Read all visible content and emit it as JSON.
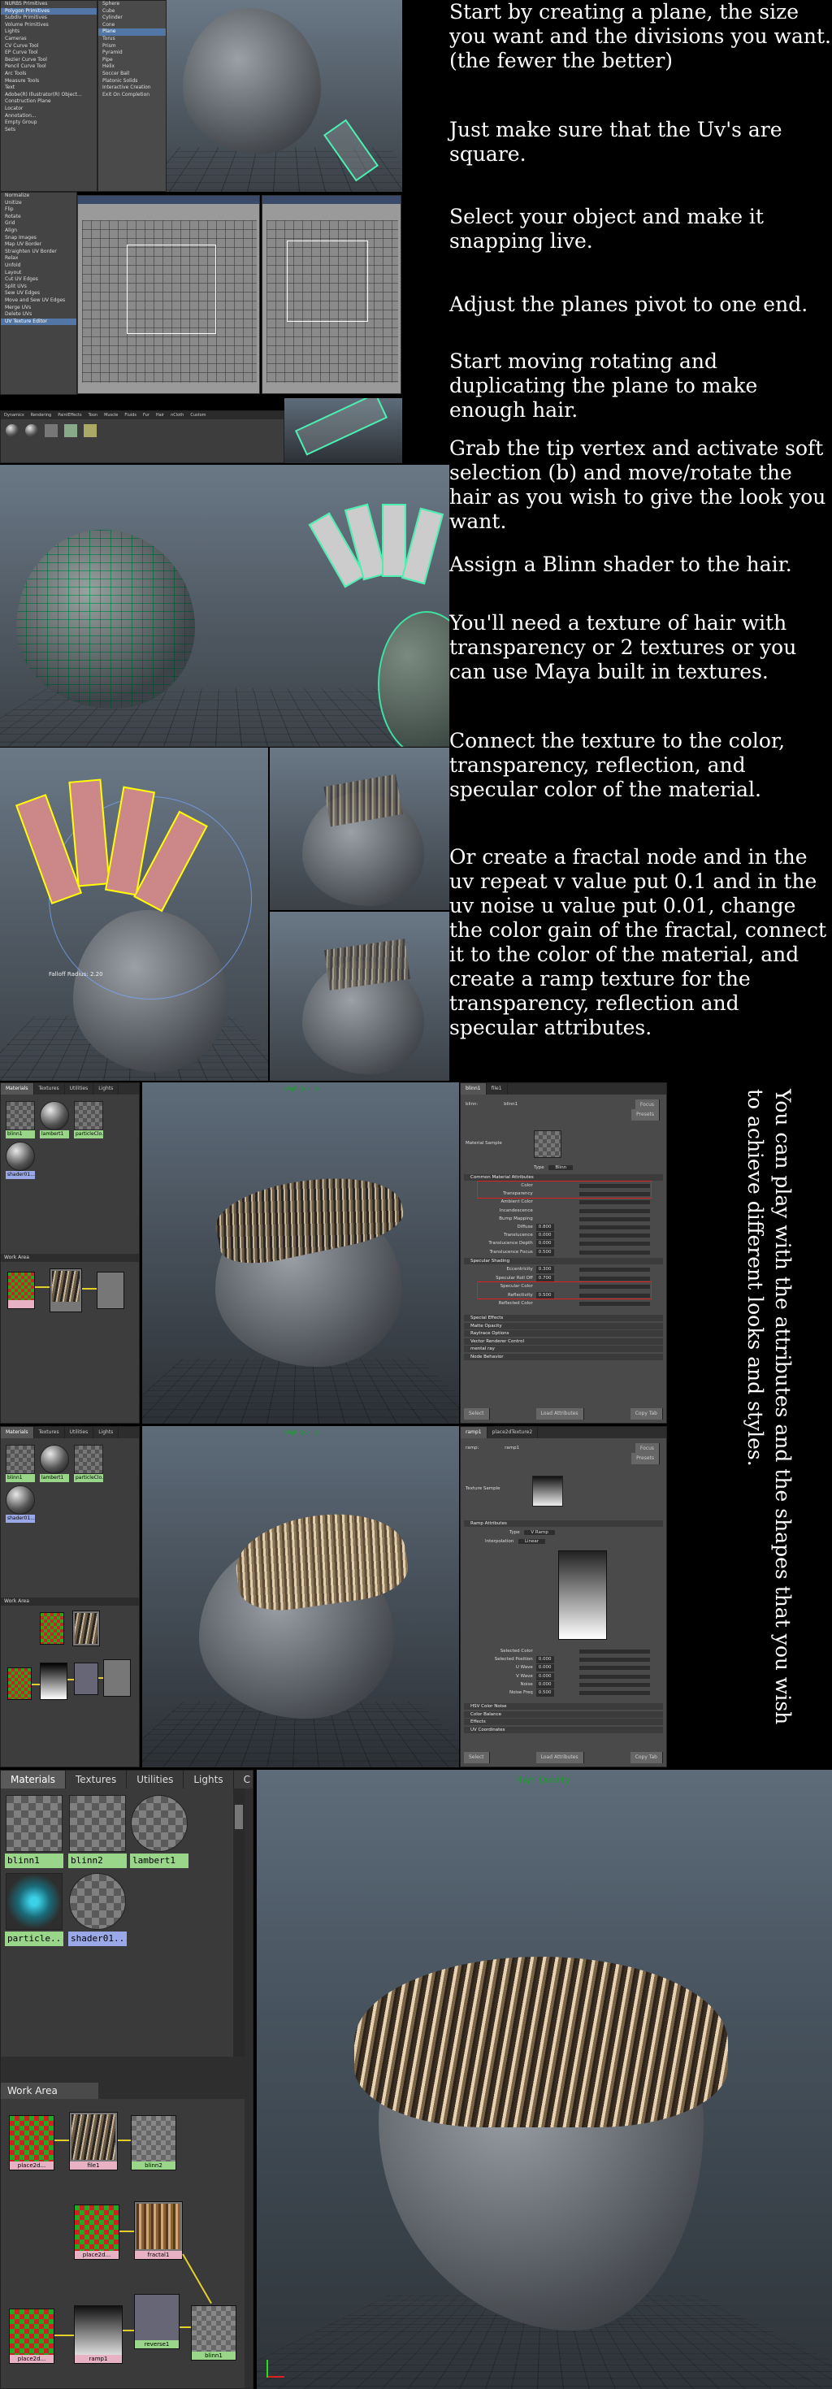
{
  "tutorial": {
    "steps": [
      "Start by creating a plane, the size you want and the divisions you want. (the fewer the better)",
      "Just make sure that the Uv's are square.",
      "Select your object and make it snapping live.",
      "Adjust the planes pivot to one end.",
      "Start moving rotating and duplicating the plane to make enough hair.",
      "Grab the tip vertex and activate soft selection (b) and move/rotate the hair as you wish to give the look you want.",
      "Assign a Blinn shader to the hair.",
      "You'll need a texture of hair with transparency or 2 textures or you can use Maya built in textures.",
      "Connect the texture to the color, transparency, reflection, and specular color of the material.",
      "Or create a fractal node and in the uv repeat v value put 0.1 and in the uv noise u value put 0.01, change the color gain of the fractal, connect it to the color of the material, and create a ramp texture for the transparency, reflection and specular attributes."
    ],
    "vertical_note": "You can play with the attributes and the shapes that you wish to achieve different looks and styles."
  },
  "create_menu": {
    "items": [
      "NURBS Primitives",
      "Polygon Primitives",
      "Subdiv Primitives",
      "Volume Primitives",
      "Lights",
      "Cameras",
      "CV Curve Tool",
      "EP Curve Tool",
      "Bezier Curve Tool",
      "Pencil Curve Tool",
      "Arc Tools",
      "Measure Tools",
      "Text",
      "Adobe(R) Illustrator(R) Object...",
      "Construction Plane",
      "Locator",
      "Annotation...",
      "Empty Group",
      "Sets"
    ],
    "selected_index": 1
  },
  "poly_submenu": {
    "items": [
      "Sphere",
      "Cube",
      "Cylinder",
      "Cone",
      "Plane",
      "Torus",
      "Prism",
      "Pyramid",
      "Pipe",
      "Helix",
      "Soccer Ball",
      "Platonic Solids",
      "Interactive Creation",
      "Exit On Completion"
    ],
    "selected_index": 4
  },
  "uv_menu": {
    "items": [
      "Normalize",
      "Unitize",
      "Flip",
      "Rotate",
      "Grid",
      "Align",
      "Snap Images",
      "Map UV Border",
      "Straighten UV Border",
      "Relax",
      "Unfold",
      "Layout",
      "Cut UV Edges",
      "Split UVs",
      "Sew UV Edges",
      "Move and Sew UV Edges",
      "Merge UVs",
      "Delete UVs",
      "UV Texture Editor"
    ],
    "selected_index": 18
  },
  "shelf_tabs": [
    "Dynamics",
    "Rendering",
    "PaintEffects",
    "Toon",
    "Muscle",
    "Fluids",
    "Fur",
    "Hair",
    "nCloth",
    "Custom"
  ],
  "soft_select_label": "Falloff Radius: 2.20",
  "render_label": "High Quality",
  "hypershade_small": {
    "tabs": [
      "Materials",
      "Textures",
      "Utilities",
      "Lights"
    ],
    "swatches": [
      "blinn1",
      "lambert1",
      "particleClo...",
      "shader01..."
    ],
    "work_area": "Work Area"
  },
  "attr_editor_1": {
    "tabs": [
      "blinn1",
      "file1"
    ],
    "node_label": "blinn:",
    "node_value": "blinn1",
    "focus": "Focus",
    "presets": "Presets",
    "sample_label": "Material Sample",
    "type_label": "Type",
    "type_value": "Blinn",
    "sections": [
      "Common Material Attributes",
      "Specular Shading",
      "Special Effects",
      "Matte Opacity",
      "Raytrace Options",
      "Vector Renderer Control",
      "mental ray",
      "Node Behavior"
    ],
    "common_rows": [
      "Color",
      "Transparency",
      "Ambient Color",
      "Incandescence",
      "Bump Mapping",
      "Diffuse",
      "Translucence",
      "Translucence Depth",
      "Translucence Focus"
    ],
    "common_values": [
      "",
      "",
      "",
      "",
      "",
      "0.800",
      "0.000",
      "0.000",
      "0.500"
    ],
    "spec_rows": [
      "Eccentricity",
      "Specular Roll Off",
      "Specular Color",
      "Reflectivity",
      "Reflected Color"
    ],
    "spec_values": [
      "0.300",
      "0.700",
      "",
      "0.500",
      ""
    ],
    "buttons": [
      "Select",
      "Load Attributes",
      "Copy Tab"
    ]
  },
  "attr_editor_2": {
    "tabs": [
      "ramp1",
      "place2dTexture2"
    ],
    "node_label": "ramp:",
    "node_value": "ramp1",
    "focus": "Focus",
    "presets": "Presets",
    "sample_label": "Texture Sample",
    "section": "Ramp Attributes",
    "type_label": "Type",
    "type_value": "V Ramp",
    "interp_label": "Interpolation",
    "interp_value": "Linear",
    "rows": [
      "Selected Color",
      "Selected Position",
      "U Wave",
      "V Wave",
      "Noise",
      "Noise Freq"
    ],
    "row_values": [
      "",
      "0.000",
      "0.000",
      "0.000",
      "0.000",
      "0.500"
    ],
    "sections": [
      "HSV Color Noise",
      "Color Balance",
      "Effects",
      "UV Coordinates"
    ],
    "buttons": [
      "Select",
      "Load Attributes",
      "Copy Tab"
    ]
  },
  "hypershade_big": {
    "tabs": [
      "Materials",
      "Textures",
      "Utilities",
      "Lights",
      "C"
    ],
    "swatches": [
      "blinn1",
      "blinn2",
      "lambert1",
      "particle...",
      "shader01..."
    ],
    "work_area": "Work Area",
    "nodes": [
      "place2d...",
      "file1",
      "blinn2",
      "place2d...",
      "fractal1",
      "place2d...",
      "ramp1",
      "reverse1",
      "blinn1"
    ]
  },
  "colors": {
    "accent_green": "#4bf0b0",
    "label_green": "#1f9a2f",
    "swatch_green": "#9ad68a",
    "selection_blue": "#5277a6",
    "highlight_red": "#e02020"
  }
}
